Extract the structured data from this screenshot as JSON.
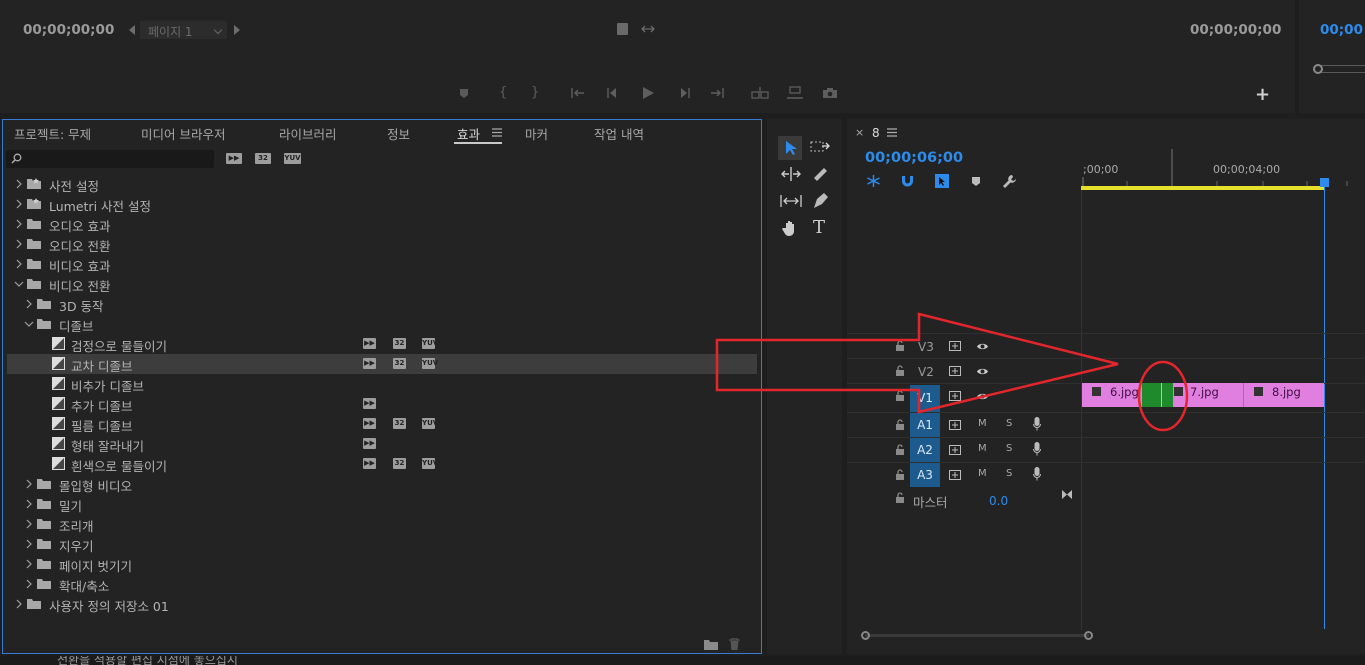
{
  "top_bar": {
    "left_timecode": "00;00;00;00",
    "page_select": "페이지 1",
    "right_timecode": "00;00;00;00",
    "far_right_timecode": "00;00"
  },
  "project_panel": {
    "tabs": [
      {
        "label": "프로젝트: 무제"
      },
      {
        "label": "미디어 브라우저"
      },
      {
        "label": "라이브러리"
      },
      {
        "label": "정보"
      },
      {
        "label": "효과"
      },
      {
        "label": "마커"
      },
      {
        "label": "작업 내역"
      }
    ],
    "active_tab": "효과",
    "search": {
      "value": "",
      "placeholder": ""
    },
    "filter_badges": [
      "32",
      "YUV"
    ],
    "tree": [
      {
        "label": "사전 설정",
        "level": 0,
        "kind": "preset-folder",
        "open": false
      },
      {
        "label": "Lumetri 사전 설정",
        "level": 0,
        "kind": "preset-folder",
        "open": false
      },
      {
        "label": "오디오 효과",
        "level": 0,
        "kind": "folder",
        "open": false
      },
      {
        "label": "오디오 전환",
        "level": 0,
        "kind": "folder",
        "open": false
      },
      {
        "label": "비디오 효과",
        "level": 0,
        "kind": "folder",
        "open": false
      },
      {
        "label": "비디오 전환",
        "level": 0,
        "kind": "folder",
        "open": true
      },
      {
        "label": "3D 동작",
        "level": 1,
        "kind": "folder",
        "open": false
      },
      {
        "label": "디졸브",
        "level": 1,
        "kind": "folder",
        "open": true
      },
      {
        "label": "검정으로 물들이기",
        "level": 2,
        "kind": "effect",
        "badges": [
          "acc",
          "32",
          "YUV"
        ]
      },
      {
        "label": "교차 디졸브",
        "level": 2,
        "kind": "effect",
        "badges": [
          "acc",
          "32",
          "YUV"
        ],
        "selected": true
      },
      {
        "label": "비추가 디졸브",
        "level": 2,
        "kind": "effect",
        "badges": []
      },
      {
        "label": "추가 디졸브",
        "level": 2,
        "kind": "effect",
        "badges": [
          "acc"
        ]
      },
      {
        "label": "필름 디졸브",
        "level": 2,
        "kind": "effect",
        "badges": [
          "acc",
          "32",
          "YUV"
        ]
      },
      {
        "label": "형태 잘라내기",
        "level": 2,
        "kind": "effect",
        "badges": [
          "acc"
        ]
      },
      {
        "label": "흰색으로 물들이기",
        "level": 2,
        "kind": "effect",
        "badges": [
          "acc",
          "32",
          "YUV"
        ]
      },
      {
        "label": "몰입형 비디오",
        "level": 1,
        "kind": "folder",
        "open": false
      },
      {
        "label": "밀기",
        "level": 1,
        "kind": "folder",
        "open": false
      },
      {
        "label": "조리개",
        "level": 1,
        "kind": "folder",
        "open": false
      },
      {
        "label": "지우기",
        "level": 1,
        "kind": "folder",
        "open": false
      },
      {
        "label": "페이지 벗기기",
        "level": 1,
        "kind": "folder",
        "open": false
      },
      {
        "label": "확대/축소",
        "level": 1,
        "kind": "folder",
        "open": false
      },
      {
        "label": "사용자 정의 저장소 01",
        "level": 0,
        "kind": "folder",
        "open": false
      }
    ]
  },
  "timeline": {
    "sequence_name": "8",
    "timecode": "00;00;06;00",
    "ruler_labels": [
      ";00;00",
      "00;00;04;00"
    ],
    "tracks": [
      {
        "name": "V3",
        "type": "video",
        "targeted": false
      },
      {
        "name": "V2",
        "type": "video",
        "targeted": false
      },
      {
        "name": "V1",
        "type": "video",
        "targeted": true
      },
      {
        "name": "A1",
        "type": "audio",
        "targeted": true
      },
      {
        "name": "A2",
        "type": "audio",
        "targeted": true
      },
      {
        "name": "A3",
        "type": "audio",
        "targeted": true
      }
    ],
    "audio_buttons": {
      "mute": "M",
      "solo": "S"
    },
    "master": {
      "label": "마스터",
      "value": "0.0"
    },
    "clips": [
      {
        "name": "6.jpg"
      },
      {
        "name": "7.jpg"
      },
      {
        "name": "8.jpg"
      }
    ]
  },
  "status_bar": {
    "text": "전환을 적용할 편집 지점에 놓으십시"
  },
  "colors": {
    "accent_blue": "#2d8ceb",
    "clip_pink": "#e17fe0",
    "transition_green": "#1f8a2b",
    "annotation_red": "#e3262c",
    "work_area_yellow": "#e6e02a"
  }
}
